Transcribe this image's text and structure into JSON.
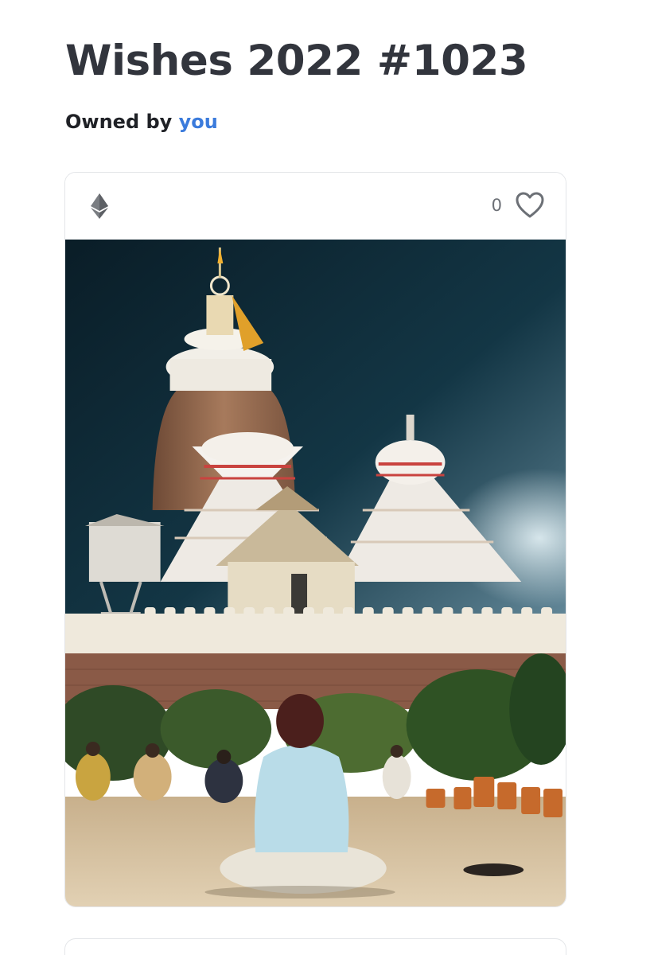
{
  "nft": {
    "title": "Wishes 2022 #1023",
    "owned_by_label": "Owned by",
    "owner": "you"
  },
  "card": {
    "currency_icon": "ethereum-icon",
    "like_count": "0",
    "like_icon": "heart-outline-icon",
    "image_subject": "temple-at-night-photo"
  },
  "colors": {
    "title": "#32353d",
    "owner_link": "#3b7bdc",
    "sky": "#0f2a36",
    "border": "#e3e5e8"
  }
}
